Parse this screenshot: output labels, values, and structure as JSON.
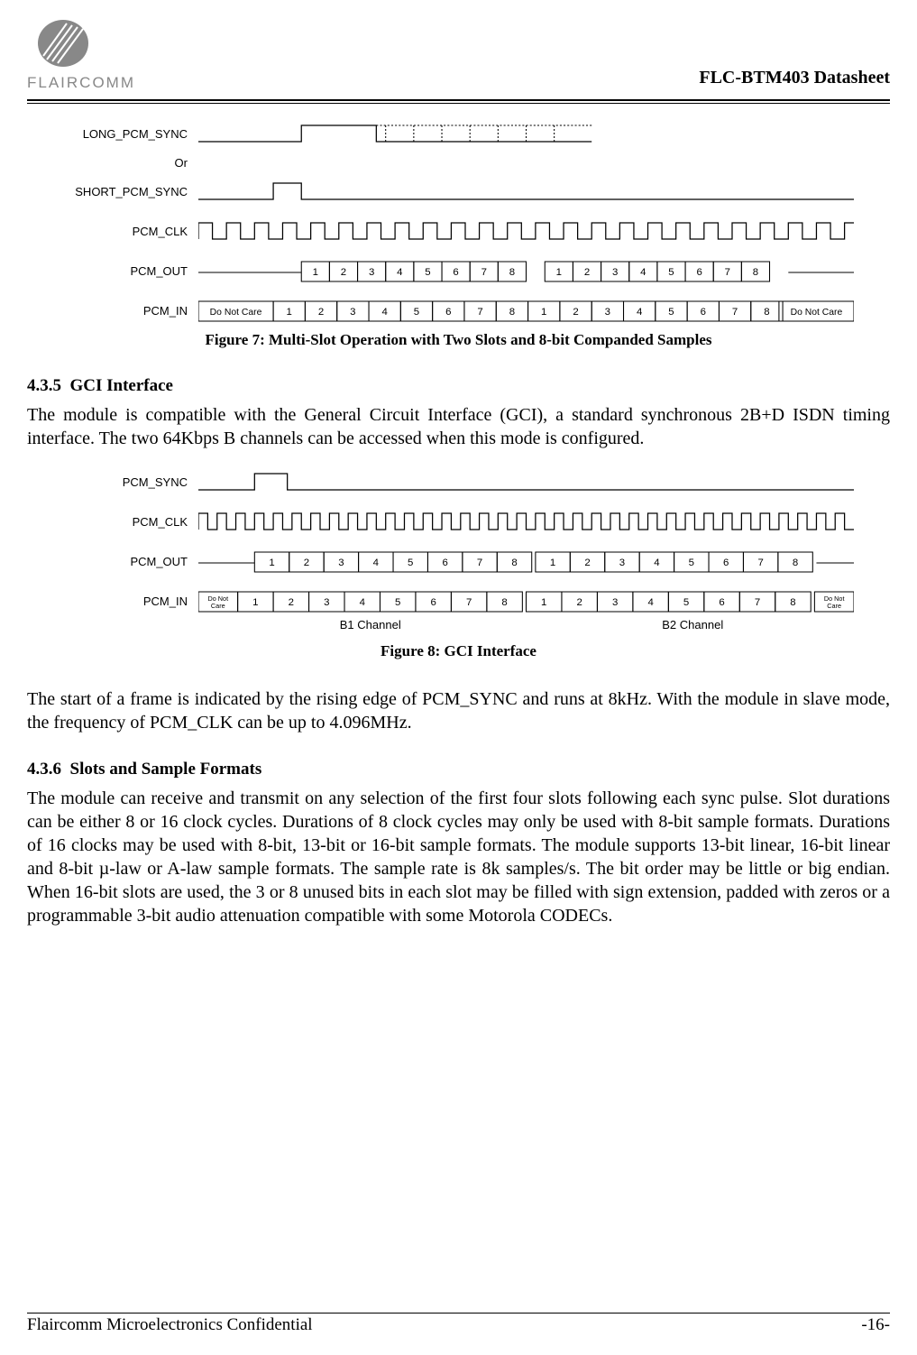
{
  "header": {
    "brand_text": "FLAIRCOMM",
    "doc_title": "FLC-BTM403 Datasheet"
  },
  "figure7": {
    "signals": {
      "long_sync": "LONG_PCM_SYNC",
      "or": "Or",
      "short_sync": "SHORT_PCM_SYNC",
      "clk": "PCM_CLK",
      "out": "PCM_OUT",
      "in": "PCM_IN"
    },
    "slots_a": [
      "1",
      "2",
      "3",
      "4",
      "5",
      "6",
      "7",
      "8"
    ],
    "slots_b": [
      "1",
      "2",
      "3",
      "4",
      "5",
      "6",
      "7",
      "8"
    ],
    "dnc": "Do Not Care",
    "caption": "Figure 7: Multi-Slot Operation with Two Slots and 8-bit Companded Samples"
  },
  "section_435": {
    "number": "4.3.5",
    "title": "GCI Interface",
    "para": "The module is compatible with the General Circuit Interface (GCI), a standard synchronous 2B+D ISDN timing interface. The two 64Kbps B channels can be accessed when this mode is configured."
  },
  "figure8": {
    "signals": {
      "sync": "PCM_SYNC",
      "clk": "PCM_CLK",
      "out": "PCM_OUT",
      "in": "PCM_IN"
    },
    "slots_a": [
      "1",
      "2",
      "3",
      "4",
      "5",
      "6",
      "7",
      "8"
    ],
    "slots_b": [
      "1",
      "2",
      "3",
      "4",
      "5",
      "6",
      "7",
      "8"
    ],
    "dnc_short": "Do Not\nCare",
    "b1": "B1 Channel",
    "b2": "B2 Channel",
    "caption": "Figure 8: GCI Interface"
  },
  "para_after_fig8": "The start of a frame is indicated by the rising edge of PCM_SYNC and runs at 8kHz. With the module in slave mode, the frequency of PCM_CLK can be up to 4.096MHz.",
  "section_436": {
    "number": "4.3.6",
    "title": "Slots and Sample Formats",
    "para": "The module can receive and transmit on any selection of the first four slots following each sync pulse. Slot durations can be either 8 or 16 clock cycles. Durations of 8 clock cycles may only be used with 8-bit sample formats. Durations of 16 clocks may be used with 8-bit, 13-bit or 16-bit sample formats. The module supports 13-bit linear, 16-bit linear and 8-bit µ-law or A-law sample formats. The sample rate is 8k samples/s. The bit order may be little or big endian. When 16-bit slots are used, the 3 or 8 unused bits in each slot may be filled with sign extension, padded with zeros or a programmable 3-bit audio attenuation compatible with some Motorola CODECs."
  },
  "footer": {
    "left": "Flaircomm Microelectronics Confidential",
    "right": "-16-"
  }
}
